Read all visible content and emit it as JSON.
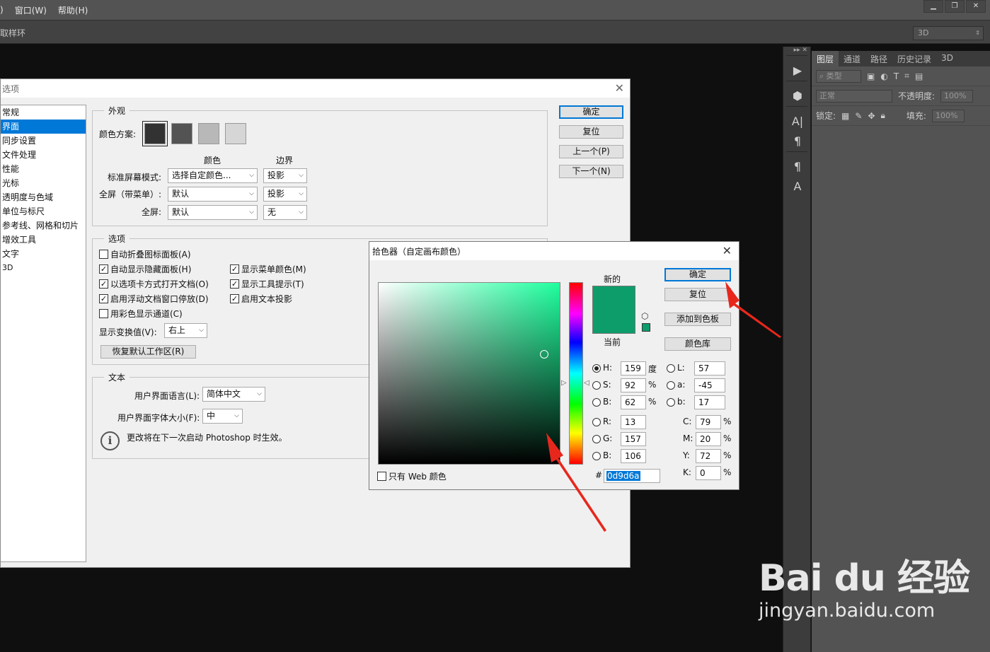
{
  "menu": {
    "items": [
      ")",
      "窗口(W)",
      "帮助(H)"
    ]
  },
  "window_controls": [
    "minimize",
    "restore",
    "close"
  ],
  "options_bar": {
    "sample_ring": "取样环",
    "workspace": "3D"
  },
  "dock_tools": [
    "play-icon",
    "3d-cube-icon",
    "character-icon",
    "paragraph-icon",
    "paragraph-style-icon",
    "character-style-icon"
  ],
  "layers_panel": {
    "tabs": [
      "图层",
      "通道",
      "路径",
      "历史记录",
      "3D"
    ],
    "kind_label": "类型",
    "blend_mode": "正常",
    "opacity_label": "不透明度:",
    "opacity_value": "100%",
    "lock_label": "锁定:",
    "fill_label": "填充:",
    "fill_value": "100%"
  },
  "preferences": {
    "title": "选项",
    "nav": [
      "常规",
      "界面",
      "同步设置",
      "文件处理",
      "性能",
      "光标",
      "透明度与色域",
      "单位与标尺",
      "参考线、网格和切片",
      "增效工具",
      "文字",
      "3D"
    ],
    "selected_nav": "界面",
    "appearance": {
      "legend": "外观",
      "color_scheme_label": "颜色方案:",
      "scheme_colors": [
        "#323232",
        "#535353",
        "#b8b8b8",
        "#d6d6d6"
      ],
      "col_color": "颜色",
      "col_border": "边界",
      "rows": [
        {
          "label": "标准屏幕模式:",
          "color": "选择自定颜色...",
          "border": "投影"
        },
        {
          "label": "全屏（带菜单）:",
          "color": "默认",
          "border": "投影"
        },
        {
          "label": "全屏:",
          "color": "默认",
          "border": "无"
        }
      ]
    },
    "options": {
      "legend": "选项",
      "checks": [
        {
          "label": "自动折叠图标面板(A)",
          "checked": false
        },
        {
          "label": "自动显示隐藏面板(H)",
          "checked": true
        },
        {
          "label": "显示菜单颜色(M)",
          "checked": true
        },
        {
          "label": "以选项卡方式打开文档(O)",
          "checked": true
        },
        {
          "label": "显示工具提示(T)",
          "checked": true
        },
        {
          "label": "启用浮动文档窗口停放(D)",
          "checked": true
        },
        {
          "label": "启用文本投影",
          "checked": true
        },
        {
          "label": "用彩色显示通道(C)",
          "checked": false
        }
      ],
      "transform_label": "显示变换值(V):",
      "transform_value": "右上",
      "restore_button": "恢复默认工作区(R)"
    },
    "text": {
      "legend": "文本",
      "lang_label": "用户界面语言(L):",
      "lang_value": "简体中文",
      "size_label": "用户界面字体大小(F):",
      "size_value": "中",
      "info": "更改将在下一次启动 Photoshop 时生效。"
    },
    "buttons": {
      "ok": "确定",
      "reset": "复位",
      "prev": "上一个(P)",
      "next": "下一个(N)"
    }
  },
  "color_picker": {
    "title": "拾色器（自定画布颜色）",
    "new_label": "新的",
    "current_label": "当前",
    "color": "#0d9d6a",
    "buttons": {
      "ok": "确定",
      "reset": "复位",
      "add_swatch": "添加到色板",
      "libraries": "颜色库"
    },
    "hsb": [
      {
        "label": "H:",
        "value": "159",
        "unit": "度",
        "selected": true
      },
      {
        "label": "S:",
        "value": "92",
        "unit": "%",
        "selected": false
      },
      {
        "label": "B:",
        "value": "62",
        "unit": "%",
        "selected": false
      }
    ],
    "rgb": [
      {
        "label": "R:",
        "value": "13"
      },
      {
        "label": "G:",
        "value": "157"
      },
      {
        "label": "B:",
        "value": "106"
      }
    ],
    "lab": [
      {
        "label": "L:",
        "value": "57"
      },
      {
        "label": "a:",
        "value": "-45"
      },
      {
        "label": "b:",
        "value": "17"
      }
    ],
    "cmyk": [
      {
        "label": "C:",
        "value": "79",
        "unit": "%"
      },
      {
        "label": "M:",
        "value": "20",
        "unit": "%"
      },
      {
        "label": "Y:",
        "value": "72",
        "unit": "%"
      },
      {
        "label": "K:",
        "value": "0",
        "unit": "%"
      }
    ],
    "hex_symbol": "#",
    "hex": "0d9d6a",
    "web_only": "只有 Web 颜色"
  },
  "watermark": {
    "logo": "Bai du 经验",
    "url": "jingyan.baidu.com"
  },
  "annotation_color": "#e8271c"
}
